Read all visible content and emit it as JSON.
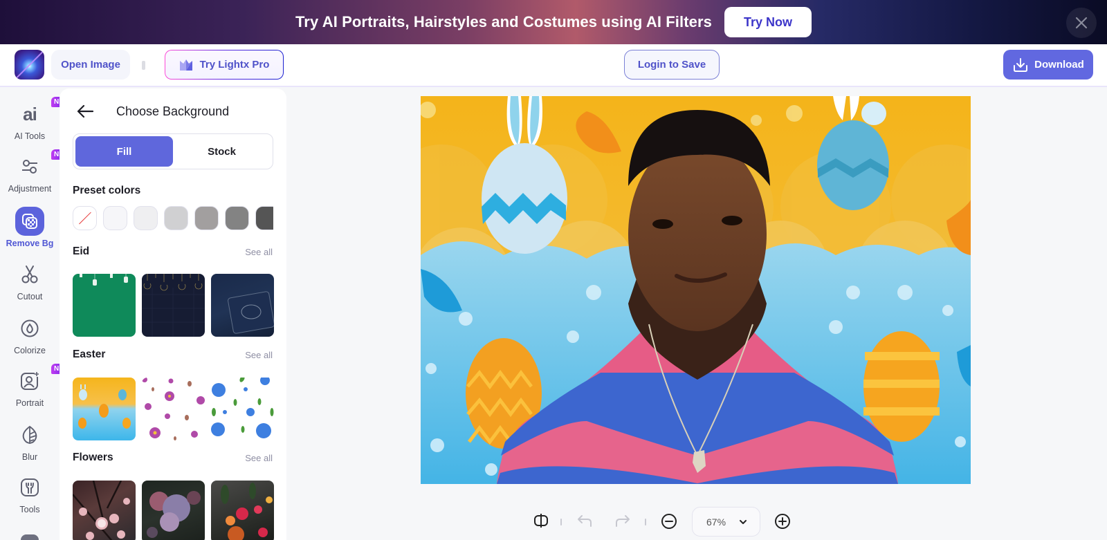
{
  "promo": {
    "text": "Try AI Portraits, Hairstyles and Costumes using AI Filters",
    "cta_label": "Try Now",
    "close_icon": "close-icon"
  },
  "header": {
    "logo_icon": "lightx-logo-icon",
    "open_image_label": "Open Image",
    "try_pro_label": "Try Lightx Pro",
    "login_save_label": "Login to Save",
    "download_label": "Download",
    "accent_color": "#6168e0"
  },
  "rail": {
    "items": [
      {
        "label": "AI Tools",
        "icon": "ai-icon",
        "badge": "NEW",
        "active": false
      },
      {
        "label": "Adjustment",
        "icon": "sliders-icon",
        "badge": "NEW",
        "active": false
      },
      {
        "label": "Remove Bg",
        "icon": "remove-bg-icon",
        "badge": "",
        "active": true
      },
      {
        "label": "Cutout",
        "icon": "scissors-icon",
        "badge": "",
        "active": false
      },
      {
        "label": "Colorize",
        "icon": "droplet-icon",
        "badge": "",
        "active": false
      },
      {
        "label": "Portrait",
        "icon": "portrait-icon",
        "badge": "NEW",
        "active": false
      },
      {
        "label": "Blur",
        "icon": "leaf-icon",
        "badge": "",
        "active": false
      },
      {
        "label": "Tools",
        "icon": "wrench-icon",
        "badge": "",
        "active": false
      }
    ]
  },
  "panel": {
    "title": "Choose Background",
    "tabs": [
      {
        "label": "Fill",
        "active": true
      },
      {
        "label": "Stock",
        "active": false
      }
    ],
    "preset_title": "Preset colors",
    "preset_colors": [
      "none",
      "#f6f6f9",
      "#efeff1",
      "#d0d0d2",
      "#a29f9f",
      "#838383",
      "#555555"
    ],
    "sections": [
      {
        "title": "Eid",
        "see_all": "See all",
        "thumbs": [
          "eid-green-lanterns",
          "eid-navy-pattern",
          "eid-quran-dark"
        ]
      },
      {
        "title": "Easter",
        "see_all": "See all",
        "thumbs": [
          "easter-eggs-yellow-blue",
          "purple-flowers-white",
          "blue-flowers-leaves"
        ]
      },
      {
        "title": "Flowers",
        "see_all": "See all",
        "thumbs": [
          "cherry-blossom",
          "hydrangea-dark",
          "roses-dark"
        ]
      }
    ]
  },
  "toolbar": {
    "compare_icon": "compare-icon",
    "undo_icon": "undo-icon",
    "redo_icon": "redo-icon",
    "zoom_out_icon": "zoom-out-icon",
    "zoom_level": "67%",
    "zoom_in_icon": "zoom-in-icon"
  }
}
